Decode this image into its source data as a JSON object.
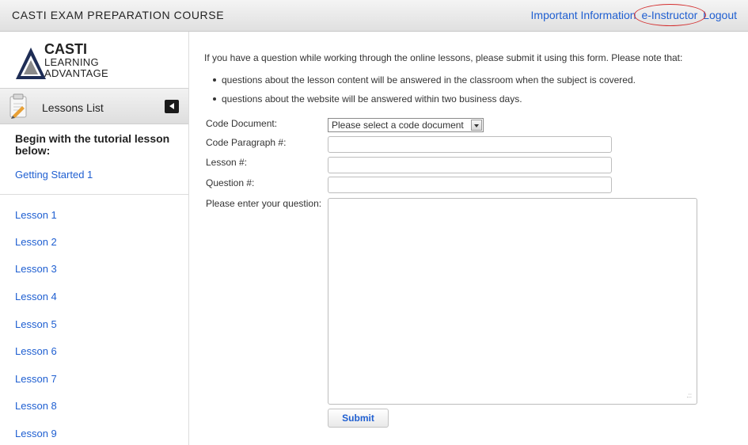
{
  "header": {
    "title": "CASTI EXAM PREPARATION COURSE",
    "nav": [
      {
        "label": "Important Information"
      },
      {
        "label": "e-Instructor"
      },
      {
        "label": "Logout"
      }
    ]
  },
  "sidebar": {
    "logo": {
      "line1": "CASTI",
      "line2": "LEARNING",
      "line3": "ADVANTAGE"
    },
    "lessons_list_label": "Lessons List",
    "tutorial_heading": "Begin with the tutorial lesson below:",
    "tutorial_link": "Getting Started 1",
    "lessons": [
      "Lesson 1",
      "Lesson 2",
      "Lesson 3",
      "Lesson 4",
      "Lesson 5",
      "Lesson 6",
      "Lesson 7",
      "Lesson 8",
      "Lesson 9"
    ]
  },
  "form": {
    "intro": "If you have a question while working through the online lessons, please submit it using this form. Please note that:",
    "bullets": [
      "questions about the lesson content will be answered in the classroom when the subject is covered.",
      "questions about the website will be answered within two business days."
    ],
    "code_document_label": "Code Document:",
    "code_document_value": "Please select a code document",
    "code_paragraph_label": "Code Paragraph #:",
    "lesson_label": "Lesson #:",
    "question_label": "Question #:",
    "question_text_label": "Please enter your question:",
    "submit_label": "Submit"
  }
}
